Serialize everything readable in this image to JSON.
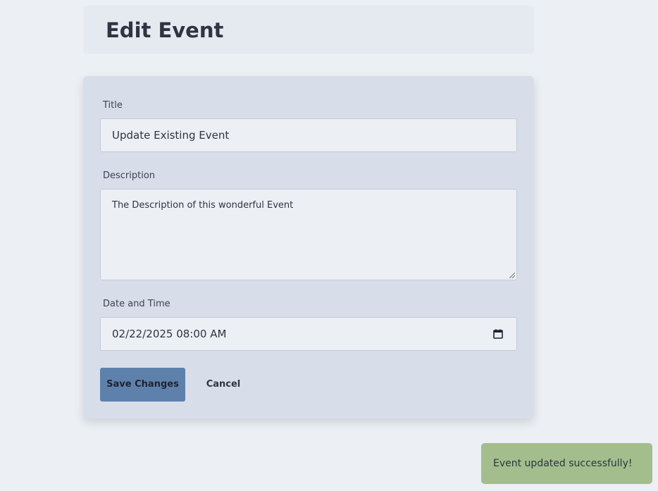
{
  "header": {
    "title": "Edit Event"
  },
  "form": {
    "title_label": "Title",
    "title_value": "Update Existing Event",
    "description_label": "Description",
    "description_value": "The Description of this wonderful Event",
    "datetime_label": "Date and Time",
    "datetime_value": "02/22/2025 08:00 AM",
    "datetime_icon": "calendar-icon",
    "save_label": "Save Changes",
    "cancel_label": "Cancel"
  },
  "toast": {
    "message": "Event updated successfully!"
  },
  "colors": {
    "background": "#eceff4",
    "header_bg": "#e5e9f0",
    "card_bg": "#d8dee9",
    "primary": "#5e81ac",
    "success": "#a3be8c",
    "text": "#2e3440"
  }
}
